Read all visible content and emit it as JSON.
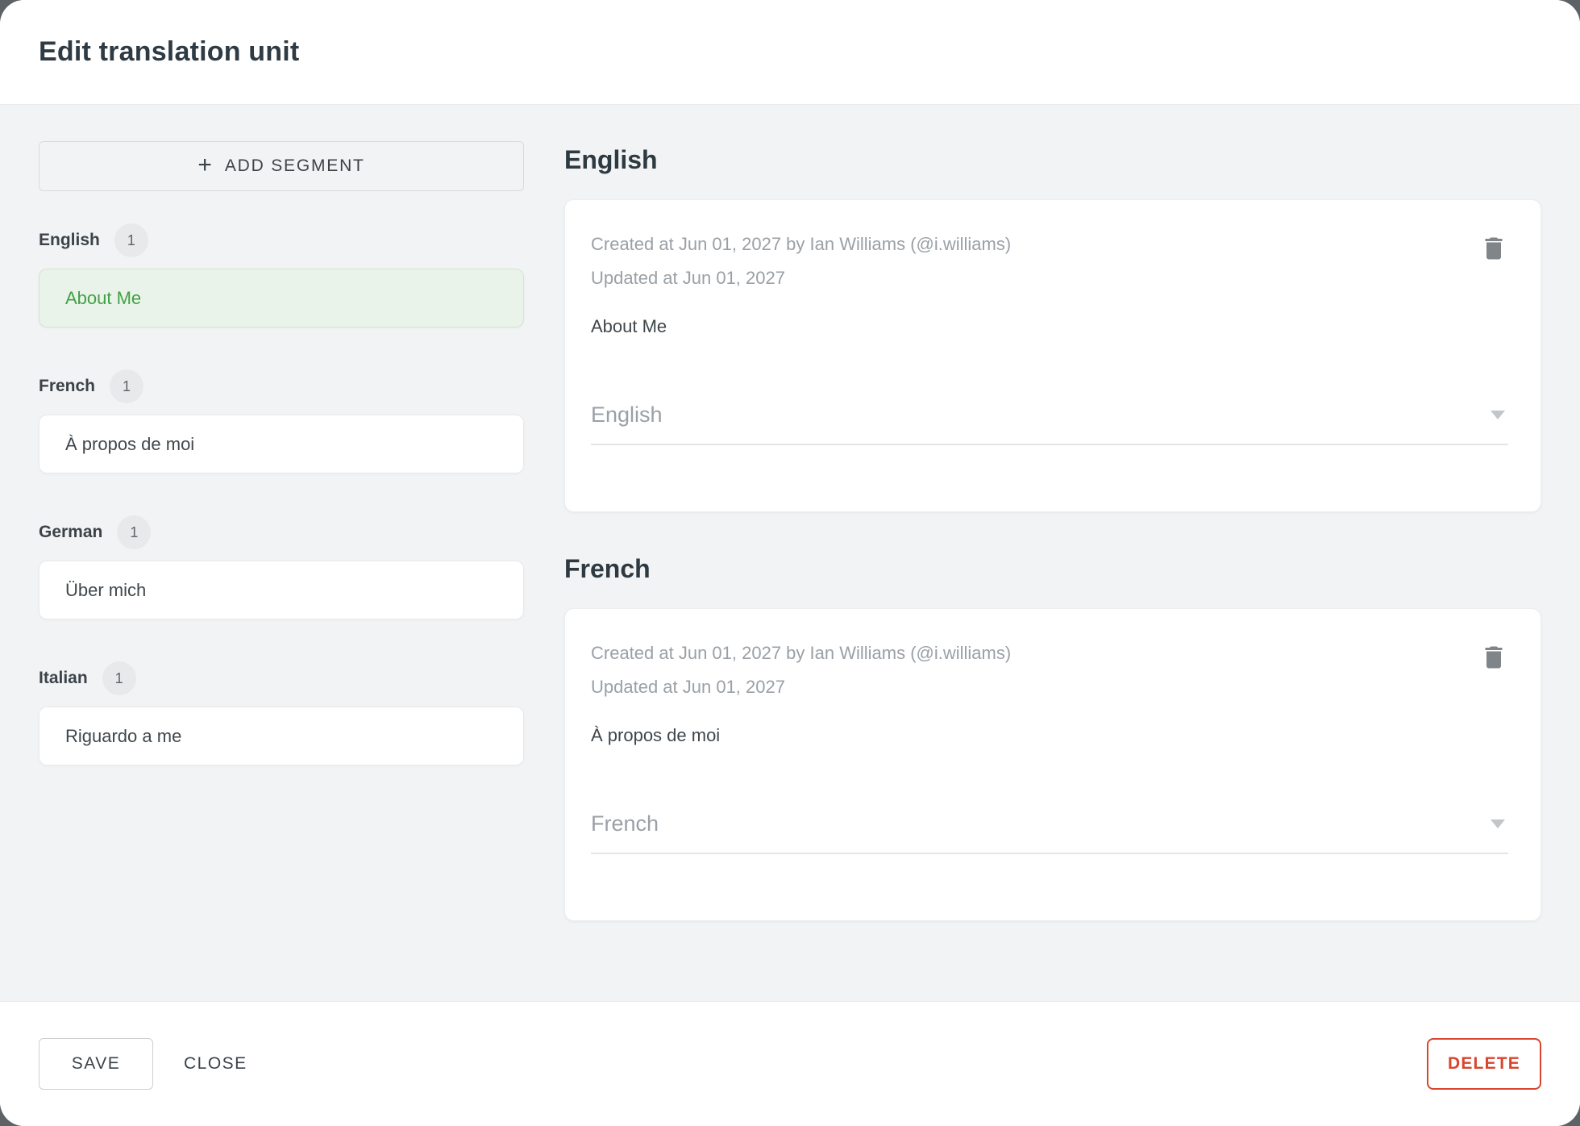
{
  "dialog": {
    "title": "Edit translation unit"
  },
  "colors": {
    "selected_segment_green": "#43a047",
    "selected_segment_bg": "#e9f3e9",
    "danger_red": "#d9452f",
    "backdrop_gray": "#5d6267"
  },
  "sidebar": {
    "add_segment_label": "ADD SEGMENT",
    "add_segment_icon": "+",
    "groups": [
      {
        "language": "English",
        "count": "1",
        "segment": "About Me",
        "selected": true
      },
      {
        "language": "French",
        "count": "1",
        "segment": "À propos de moi",
        "selected": false
      },
      {
        "language": "German",
        "count": "1",
        "segment": "Über mich",
        "selected": false
      },
      {
        "language": "Italian",
        "count": "1",
        "segment": "Riguardo a me",
        "selected": false
      }
    ]
  },
  "main": {
    "sections": [
      {
        "heading": "English",
        "created_line": "Created at Jun 01, 2027 by Ian Williams (@i.williams)",
        "updated_line": "Updated at Jun 01, 2027",
        "text": "About Me",
        "language_select": "English"
      },
      {
        "heading": "French",
        "created_line": "Created at Jun 01, 2027 by Ian Williams (@i.williams)",
        "updated_line": "Updated at Jun 01, 2027",
        "text": "À propos de moi",
        "language_select": "French"
      }
    ]
  },
  "footer": {
    "save_label": "SAVE",
    "close_label": "CLOSE",
    "delete_label": "DELETE"
  }
}
